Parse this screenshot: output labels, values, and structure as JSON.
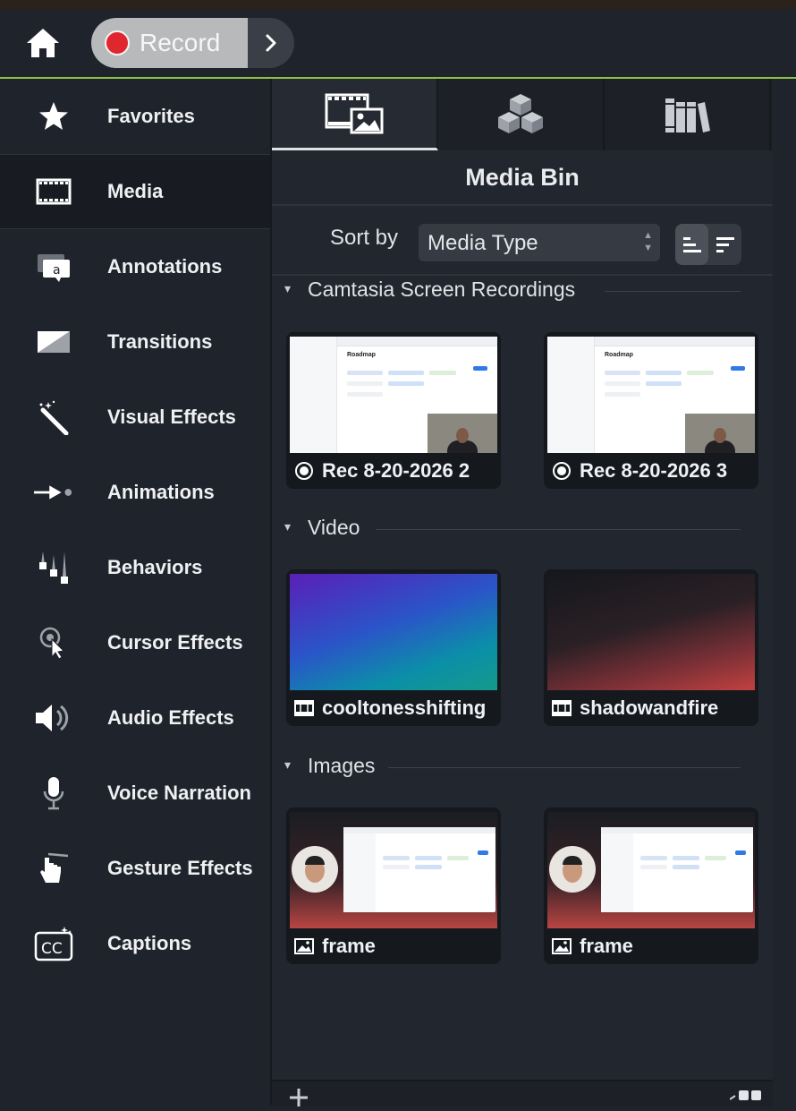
{
  "topbar": {
    "record_label": "Record",
    "home_icon": "home-icon",
    "more_icon": "chevron-right-icon"
  },
  "colors": {
    "accent_line": "#8bc34a",
    "record_red": "#e0262e",
    "sidebar_bg": "#1f232b",
    "panel_bg": "#22262e"
  },
  "sidebar": {
    "items": [
      {
        "label": "Favorites",
        "icon": "star-icon"
      },
      {
        "label": "Media",
        "icon": "film-icon",
        "active": true
      },
      {
        "label": "Annotations",
        "icon": "callout-icon"
      },
      {
        "label": "Transitions",
        "icon": "transition-icon"
      },
      {
        "label": "Visual Effects",
        "icon": "magic-wand-icon"
      },
      {
        "label": "Animations",
        "icon": "animation-arrow-icon"
      },
      {
        "label": "Behaviors",
        "icon": "behaviors-icon"
      },
      {
        "label": "Cursor Effects",
        "icon": "cursor-icon"
      },
      {
        "label": "Audio Effects",
        "icon": "speaker-icon"
      },
      {
        "label": "Voice Narration",
        "icon": "microphone-icon"
      },
      {
        "label": "Gesture Effects",
        "icon": "gesture-hand-icon"
      },
      {
        "label": "Captions",
        "icon": "cc-icon"
      }
    ]
  },
  "panel": {
    "tabs": [
      {
        "icon": "media-bin-icon",
        "active": true
      },
      {
        "icon": "library-cubes-icon"
      },
      {
        "icon": "books-icon"
      }
    ],
    "title": "Media Bin",
    "sort": {
      "label": "Sort by",
      "value": "Media Type"
    },
    "sections": [
      {
        "label": "Camtasia Screen Recordings",
        "items": [
          {
            "label": "Rec 8-20-2026 2",
            "icon": "recording-icon"
          },
          {
            "label": "Rec 8-20-2026 3",
            "icon": "recording-icon"
          }
        ]
      },
      {
        "label": "Video",
        "items": [
          {
            "label": "cooltonesshifting",
            "icon": "film-icon"
          },
          {
            "label": "shadowandfire",
            "icon": "film-icon"
          }
        ]
      },
      {
        "label": "Images",
        "items": [
          {
            "label": "frame",
            "icon": "image-icon"
          },
          {
            "label": "frame",
            "icon": "image-icon"
          }
        ]
      }
    ],
    "thumb_text": {
      "roadmap": "Roadmap"
    }
  }
}
